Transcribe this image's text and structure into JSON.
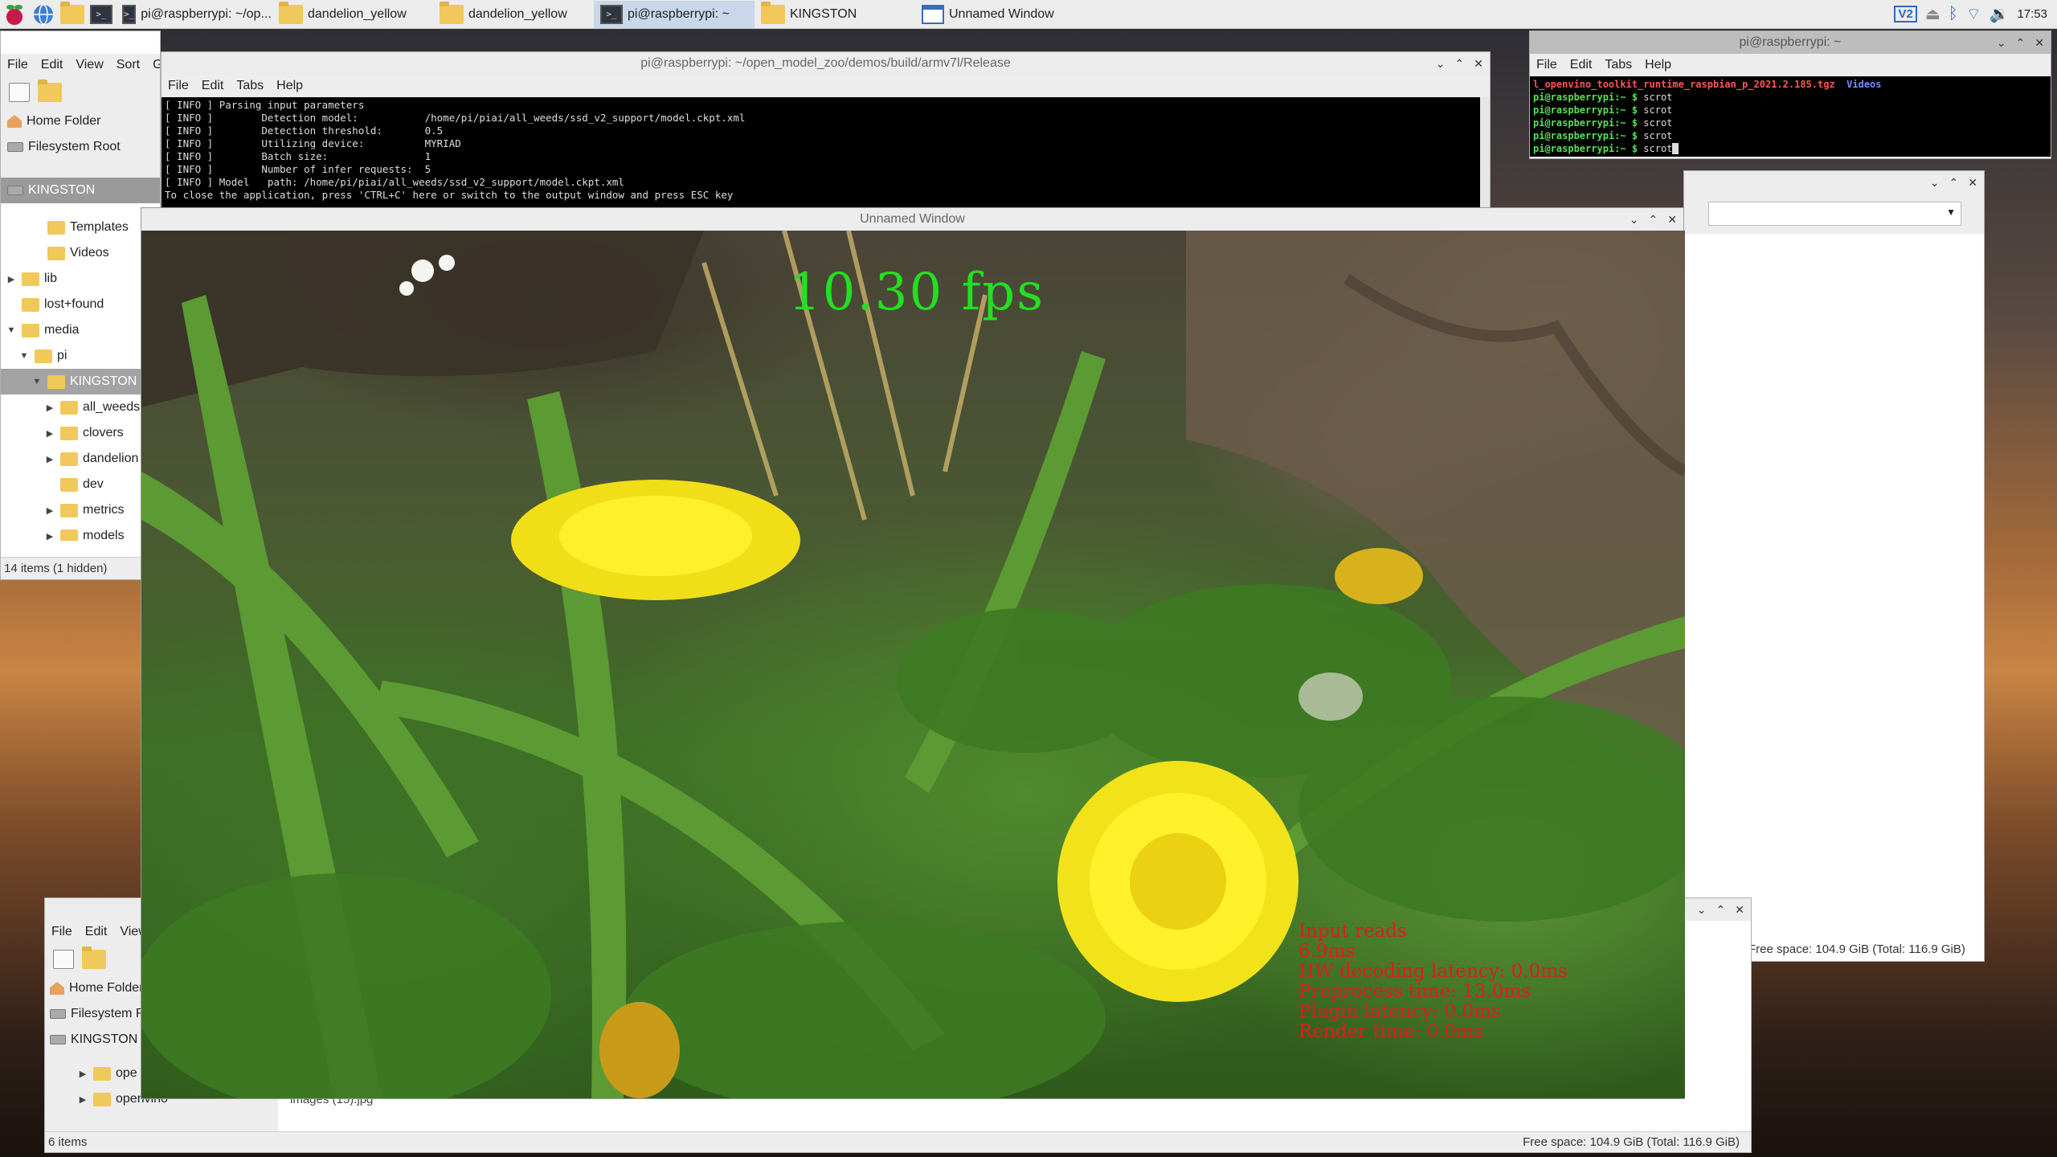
{
  "taskbar": {
    "tasks": [
      {
        "label": "pi@raspberrypi: ~/op...",
        "icon": "terminal-icon"
      },
      {
        "label": "dandelion_yellow",
        "icon": "folder-icon"
      },
      {
        "label": "dandelion_yellow",
        "icon": "folder-icon"
      },
      {
        "label": "pi@raspberrypi: ~",
        "icon": "terminal-icon"
      },
      {
        "label": "KINGSTON",
        "icon": "folder-icon"
      },
      {
        "label": "Unnamed Window",
        "icon": "window-icon"
      }
    ],
    "vnc_label": "V2",
    "clock": "17:53"
  },
  "fm_main": {
    "title": "KINGSTON",
    "menu": [
      "File",
      "Edit",
      "View",
      "Sort",
      "Go"
    ],
    "places": [
      "Home Folder",
      "Filesystem Root",
      "KINGSTON"
    ],
    "tree": [
      {
        "label": "Templates",
        "type": "folder",
        "indent": 2
      },
      {
        "label": "Videos",
        "type": "folder",
        "indent": 2
      },
      {
        "label": "lib",
        "type": "folder",
        "indent": 0,
        "arrow": "▶"
      },
      {
        "label": "lost+found",
        "type": "folder",
        "indent": 0
      },
      {
        "label": "media",
        "type": "folder",
        "indent": 0,
        "arrow": "▼"
      },
      {
        "label": "pi",
        "type": "folder",
        "indent": 1,
        "arrow": "▼"
      },
      {
        "label": "KINGSTON",
        "type": "folder",
        "indent": 2,
        "arrow": "▼",
        "selected": true
      },
      {
        "label": "all_weeds",
        "type": "folder",
        "indent": 3,
        "arrow": "▶"
      },
      {
        "label": "clovers",
        "type": "folder",
        "indent": 3,
        "arrow": "▶"
      },
      {
        "label": "dandelion",
        "type": "folder",
        "indent": 3,
        "arrow": "▶"
      },
      {
        "label": "dev",
        "type": "folder",
        "indent": 3
      },
      {
        "label": "metrics",
        "type": "folder",
        "indent": 3,
        "arrow": "▶"
      },
      {
        "label": "models",
        "type": "folder",
        "indent": 3,
        "arrow": "▶"
      }
    ],
    "status": "14 items (1 hidden)"
  },
  "term_main": {
    "title": "pi@raspberrypi: ~/open_model_zoo/demos/build/armv7l/Release",
    "menu": [
      "File",
      "Edit",
      "Tabs",
      "Help"
    ],
    "lines": [
      "[ INFO ] Parsing input parameters",
      "[ INFO ]        Detection model:           /home/pi/piai/all_weeds/ssd_v2_support/model.ckpt.xml",
      "[ INFO ]        Detection threshold:       0.5",
      "[ INFO ]        Utilizing device:          MYRIAD",
      "[ INFO ]        Batch size:                1",
      "[ INFO ]        Number of infer requests:  5",
      "[ INFO ] Model   path: /home/pi/piai/all_weeds/ssd_v2_support/model.ckpt.xml",
      "To close the application, press 'CTRL+C' here or switch to the output window and press ESC key"
    ]
  },
  "term_right": {
    "title": "pi@raspberrypi: ~",
    "menu": [
      "File",
      "Edit",
      "Tabs",
      "Help"
    ],
    "file_line": "l_openvino_toolkit_runtime_raspbian_p_2021.2.185.tgz",
    "dir_name": "Videos",
    "prompt": "pi@raspberrypi:~ $ ",
    "commands": [
      "scrot",
      "scrot",
      "scrot",
      "scrot",
      "scrot"
    ]
  },
  "fm_right": {
    "status": "Free space: 104.9 GiB (Total: 116.9 GiB)"
  },
  "fm_bottom": {
    "menu": [
      "File",
      "Edit",
      "View"
    ],
    "places": [
      "Home Folder",
      "Filesystem R",
      "KINGSTON"
    ],
    "tree": [
      "ope",
      "openvino"
    ],
    "status_left": "6 items",
    "file_partial": "images (15).jpg",
    "status_right": "Free space: 104.9 GiB (Total: 116.9 GiB)"
  },
  "video": {
    "title": "Unnamed Window",
    "fps": "10.30 fps",
    "metrics": [
      "Input reads",
      "6.9ms",
      "HW decoding latency: 0.0ms",
      "Preprocess time: 13.0ms",
      "Plugin latency: 0.0ms",
      "Render time: 0.0ms"
    ]
  }
}
